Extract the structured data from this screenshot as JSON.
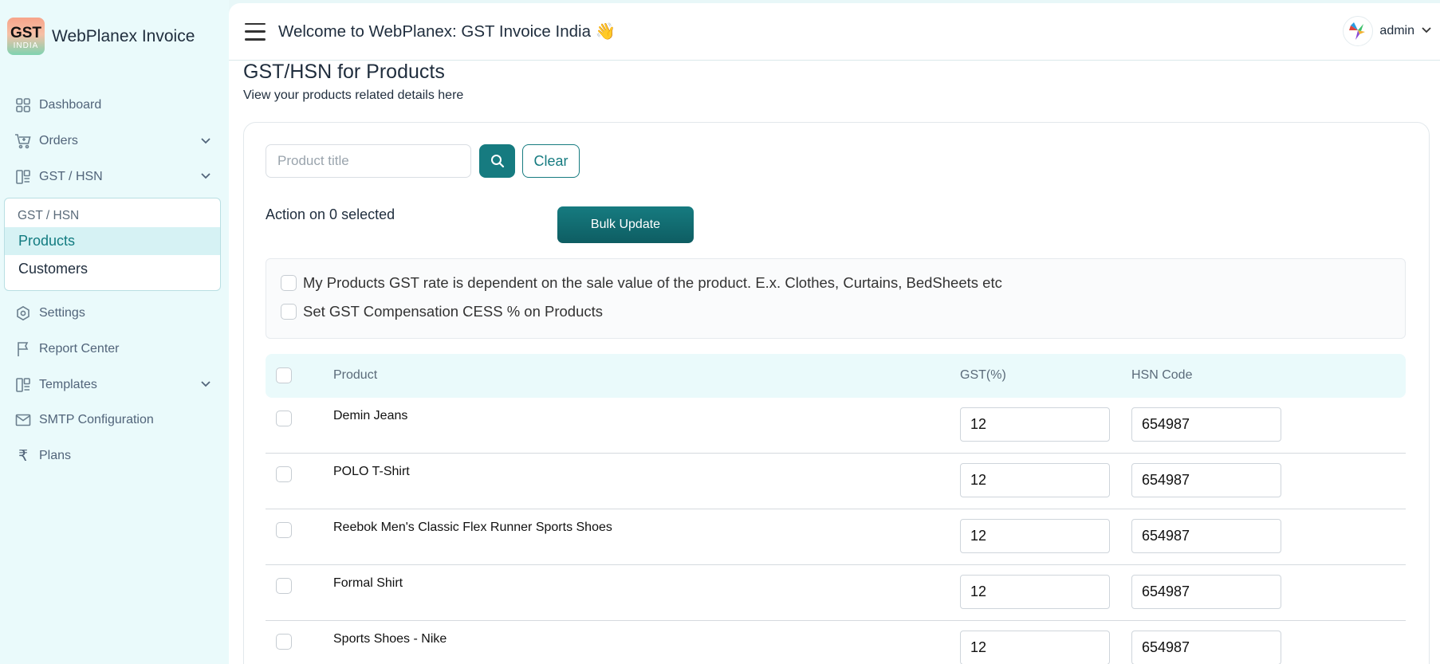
{
  "app": {
    "logo_line1": "GST",
    "logo_line2": "INDIA",
    "name": "WebPlanex Invoice"
  },
  "header": {
    "welcome": "Welcome to WebPlanex: GST Invoice India 👋",
    "user_name": "admin"
  },
  "sidebar": {
    "items": [
      {
        "label": "Dashboard",
        "icon": "dashboard-grid-icon"
      },
      {
        "label": "Orders",
        "icon": "cart-icon",
        "expandable": true
      },
      {
        "label": "GST / HSN",
        "icon": "layout-icon",
        "expandable": true
      },
      {
        "label": "Settings",
        "icon": "settings-hex-icon"
      },
      {
        "label": "Report Center",
        "icon": "flag-icon"
      },
      {
        "label": "Templates",
        "icon": "layout-icon",
        "expandable": true
      },
      {
        "label": "SMTP Configuration",
        "icon": "mail-icon"
      },
      {
        "label": "Plans",
        "icon": "rupee-icon"
      }
    ],
    "submenu": {
      "header": "GST / HSN",
      "items": [
        "Products",
        "Customers"
      ],
      "active": "Products"
    }
  },
  "page": {
    "title": "GST/HSN for Products",
    "subtitle": "View your products related details here"
  },
  "search": {
    "placeholder": "Product title",
    "value": "",
    "clear_label": "Clear"
  },
  "bulk": {
    "action_label": "Action on 0 selected",
    "button_label": "Bulk Update"
  },
  "options": [
    {
      "label": "My Products GST rate is dependent on the sale value of the product. E.x. Clothes, Curtains, BedSheets etc",
      "checked": false
    },
    {
      "label": "Set GST Compensation CESS % on Products",
      "checked": false
    }
  ],
  "table": {
    "columns": [
      "Product",
      "GST(%)",
      "HSN Code"
    ],
    "rows": [
      {
        "product": "Demin Jeans",
        "gst": "12",
        "hsn": "654987"
      },
      {
        "product": "POLO T-Shirt",
        "gst": "12",
        "hsn": "654987"
      },
      {
        "product": "Reebok Men's Classic Flex Runner Sports Shoes",
        "gst": "12",
        "hsn": "654987"
      },
      {
        "product": "Formal Shirt",
        "gst": "12",
        "hsn": "654987"
      },
      {
        "product": "Sports Shoes - Nike",
        "gst": "12",
        "hsn": "654987"
      }
    ]
  },
  "colors": {
    "primary": "#167b80",
    "sidebar_bg": "#eafafb",
    "active_bg": "#d6f2f4"
  }
}
